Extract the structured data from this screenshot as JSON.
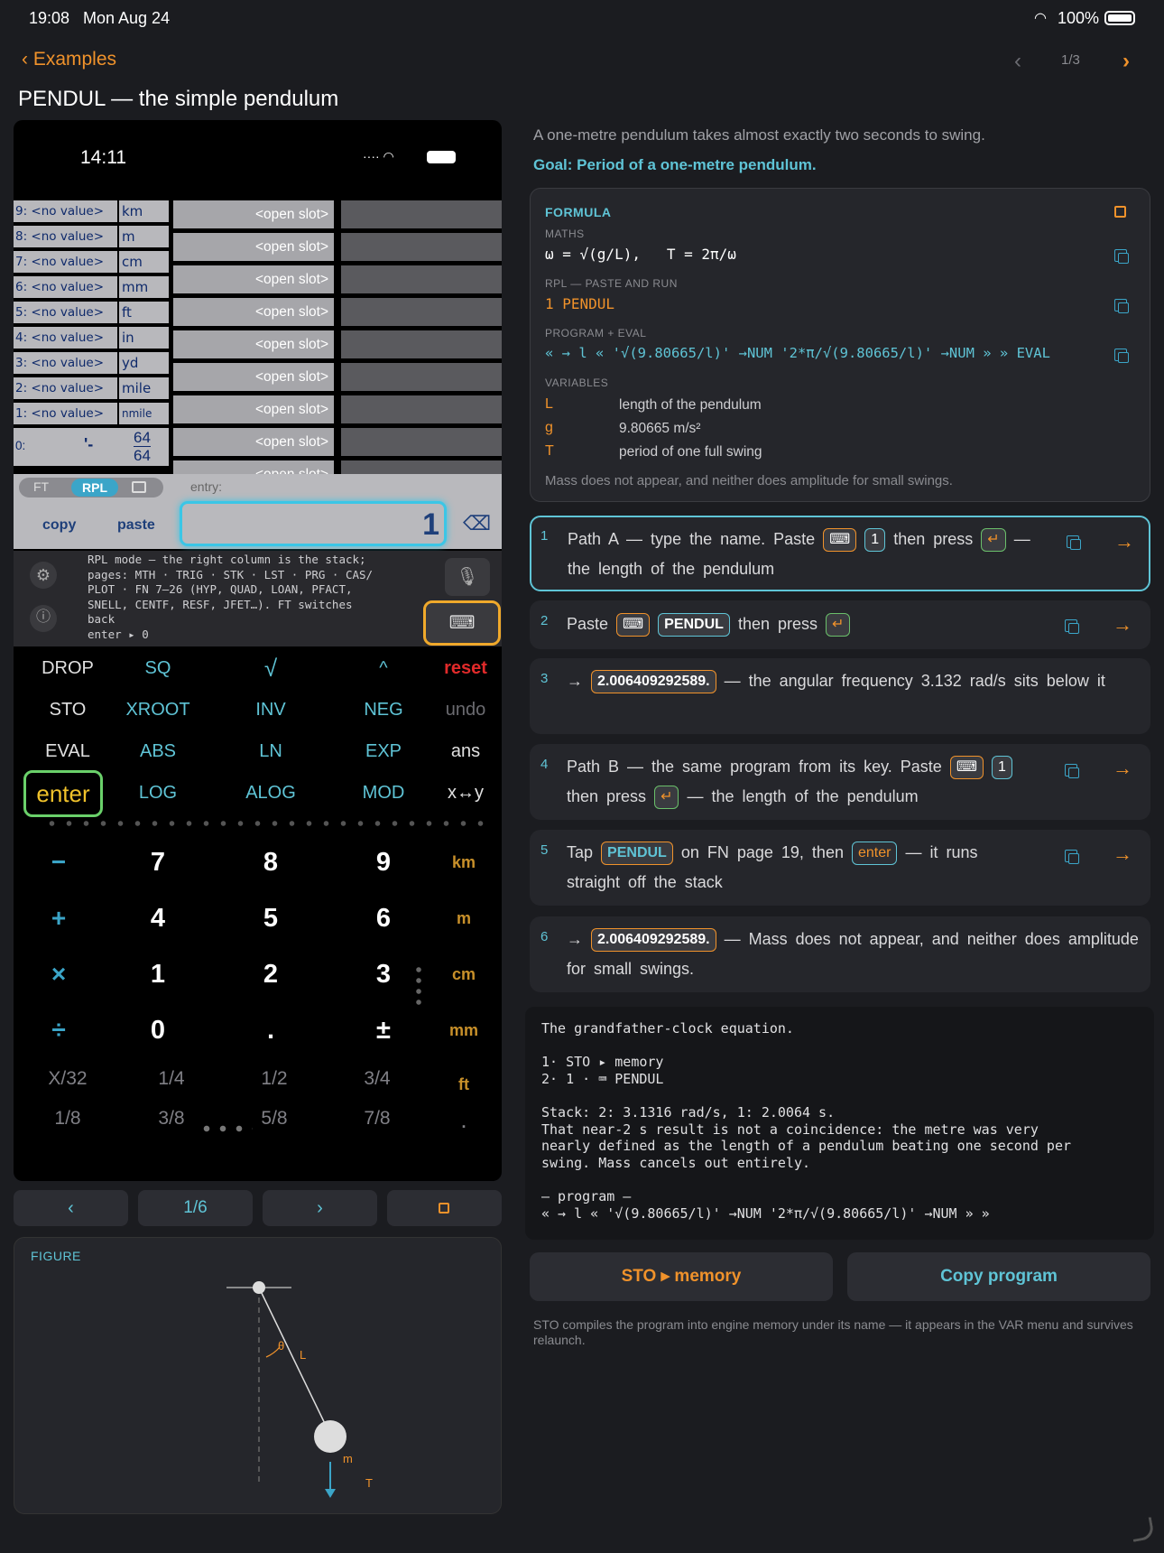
{
  "status": {
    "time": "19:08",
    "date": "Mon Aug 24",
    "battery": "100%"
  },
  "nav": {
    "back": "‹ Examples",
    "page": "1/3",
    "prev": "‹",
    "next": "›"
  },
  "title": "PENDUL — the simple pendulum",
  "phone": {
    "time": "14:11",
    "registers": [
      {
        "idx": "9:  <no value>",
        "unit": "km"
      },
      {
        "idx": "8:  <no value>",
        "unit": "m"
      },
      {
        "idx": "7:  <no value>",
        "unit": "cm"
      },
      {
        "idx": "6:  <no value>",
        "unit": "mm"
      },
      {
        "idx": "5:  <no value>",
        "unit": "ft"
      },
      {
        "idx": "4:  <no value>",
        "unit": "in"
      },
      {
        "idx": "3:  <no value>",
        "unit": "yd"
      },
      {
        "idx": "2:  <no value>",
        "unit": "mile"
      },
      {
        "idx": "1:  <no value>",
        "unit": "nmile"
      }
    ],
    "level0": "0:",
    "level0_value": "'-",
    "frac_num": "64",
    "frac_den": "64",
    "slot_label": "<open slot>",
    "mode_ft": "FT",
    "mode_rpl": "RPL",
    "entry_label": "entry:",
    "copy": "copy",
    "paste": "paste",
    "entry_value": "1",
    "help_text": "RPL mode — the right column is the stack;\npages: MTH · TRIG · STK · LST · PRG · CAS/\nPLOT · FN 7–26 (HYP, QUAD, LOAN, PFACT,\nSNELL, CENTF, RESF, JFET…). FT switches\nback\nenter ▸ 0",
    "keys_row1": [
      "DROP",
      "SQ",
      "√",
      "^",
      "reset"
    ],
    "keys_row2": [
      "STO",
      "XROOT",
      "INV",
      "NEG",
      "undo"
    ],
    "keys_row3": [
      "EVAL",
      "ABS",
      "LN",
      "EXP",
      "ans"
    ],
    "keys_row4": [
      "enter",
      "LOG",
      "ALOG",
      "MOD",
      "x↔y"
    ],
    "num_rows": [
      [
        "−",
        "7",
        "8",
        "9",
        "km"
      ],
      [
        "+",
        "4",
        "5",
        "6",
        "m"
      ],
      [
        "×",
        "1",
        "2",
        "3",
        "cm"
      ],
      [
        "÷",
        "0",
        ".",
        "±",
        "mm"
      ]
    ],
    "frac_row1": [
      "X/32",
      "1/4",
      "1/2",
      "3/4",
      "ft"
    ],
    "frac_row2": [
      "1/8",
      "3/8",
      "5/8",
      "7/8",
      "."
    ]
  },
  "phone_nav": {
    "prev": "‹",
    "page": "1/6",
    "next": "›"
  },
  "figure": {
    "label": "FIGURE",
    "theta": "θ",
    "L": "L",
    "m": "m",
    "T": "T"
  },
  "intro": "A one-metre pendulum takes almost exactly two seconds to swing.",
  "goal": "Goal: Period of a one-metre pendulum.",
  "formula": {
    "heading": "FORMULA",
    "maths_label": "MATHS",
    "maths": "ω = √(g/L),   T = 2π/ω",
    "rpl_label": "RPL — PASTE AND RUN",
    "rpl": "1 PENDUL",
    "program_label": "PROGRAM + EVAL",
    "program": "« → l « '√(9.80665/l)' →NUM '2*π/√(9.80665/l)' →NUM » » EVAL",
    "variables_label": "VARIABLES",
    "variables": [
      {
        "name": "L",
        "desc": "length of the pendulum"
      },
      {
        "name": "g",
        "desc": "9.80665 m/s²"
      },
      {
        "name": "T",
        "desc": "period of one full swing"
      }
    ],
    "note": "Mass does not appear, and neither does amplitude for small swings."
  },
  "steps": {
    "s1": {
      "num": "1",
      "a": "Path A — type the name. Paste",
      "chip": "1",
      "b": "then press",
      "c": "— the length of the pendulum"
    },
    "s2": {
      "num": "2",
      "a": "Paste",
      "chip": "PENDUL",
      "b": "then press"
    },
    "s3": {
      "num": "3",
      "a": "→",
      "chip": "2.006409292589.",
      "b": "— the angular frequency 3.132 rad/s sits below it"
    },
    "s4": {
      "num": "4",
      "a": "Path B — the same program from its key. Paste",
      "chip": "1",
      "b": "then press",
      "c": "— the length of the pendulum"
    },
    "s5": {
      "num": "5",
      "a": "Tap",
      "chip": "PENDUL",
      "b": "on FN page 19, then",
      "chip2": "enter",
      "c": "— it runs straight off the stack"
    },
    "s6": {
      "num": "6",
      "a": "→",
      "chip": "2.006409292589.",
      "b": "— Mass does not appear, and neither does amplitude for small swings."
    }
  },
  "notes": "The grandfather-clock equation.\n\n1· STO ▸ memory\n2· 1 · ⌨ PENDUL\n\nStack: 2: 3.1316 rad/s, 1: 2.0064 s.\nThat near-2 s result is not a coincidence: the metre was very\nnearly defined as the length of a pendulum beating one second per\nswing. Mass cancels out entirely.\n\n— program —\n« → l « '√(9.80665/l)' →NUM '2*π/√(9.80665/l)' →NUM » »",
  "buttons": {
    "sto": "STO ▸ memory",
    "copy": "Copy program"
  },
  "footer": "STO compiles the program into engine memory under its name — it appears in the VAR menu and survives relaunch.",
  "colors": {
    "accent_orange": "#f0922b",
    "accent_cyan": "#5fc4d6",
    "background": "#1b1c20"
  }
}
